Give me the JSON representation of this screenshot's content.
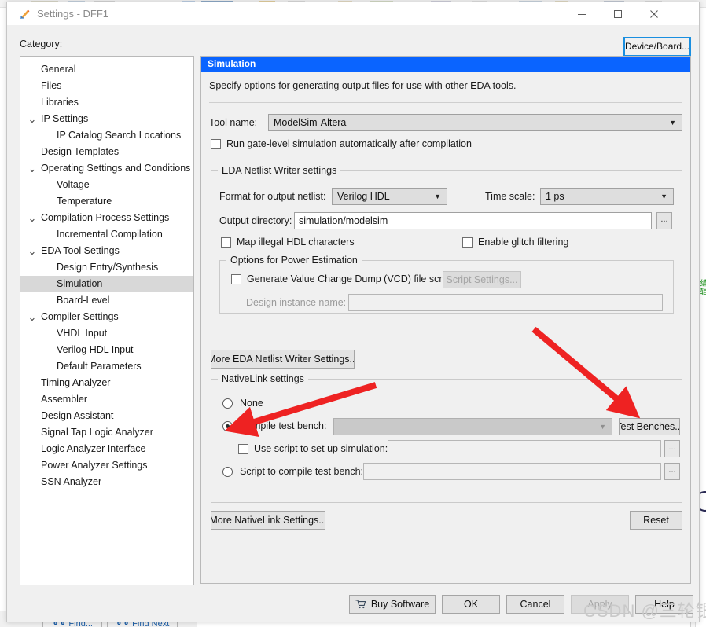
{
  "window": {
    "title": "Settings - DFF1",
    "icon": "pencil-icon",
    "minimize": "—",
    "maximize": "☐",
    "close": "✕"
  },
  "background": {
    "green_text": "编辑",
    "find_button": "Find...",
    "find_next_button": "Find Next"
  },
  "category": {
    "label": "Category:",
    "device_board_button": "Device/Board...",
    "items": [
      {
        "label": "General",
        "depth": 0,
        "expandable": false,
        "selected": false
      },
      {
        "label": "Files",
        "depth": 0,
        "expandable": false,
        "selected": false
      },
      {
        "label": "Libraries",
        "depth": 0,
        "expandable": false,
        "selected": false
      },
      {
        "label": "IP Settings",
        "depth": 0,
        "expandable": true,
        "selected": false
      },
      {
        "label": "IP Catalog Search Locations",
        "depth": 1,
        "expandable": false,
        "selected": false
      },
      {
        "label": "Design Templates",
        "depth": 0,
        "expandable": false,
        "selected": false
      },
      {
        "label": "Operating Settings and Conditions",
        "depth": 0,
        "expandable": true,
        "selected": false
      },
      {
        "label": "Voltage",
        "depth": 1,
        "expandable": false,
        "selected": false
      },
      {
        "label": "Temperature",
        "depth": 1,
        "expandable": false,
        "selected": false
      },
      {
        "label": "Compilation Process Settings",
        "depth": 0,
        "expandable": true,
        "selected": false
      },
      {
        "label": "Incremental Compilation",
        "depth": 1,
        "expandable": false,
        "selected": false
      },
      {
        "label": "EDA Tool Settings",
        "depth": 0,
        "expandable": true,
        "selected": false
      },
      {
        "label": "Design Entry/Synthesis",
        "depth": 1,
        "expandable": false,
        "selected": false
      },
      {
        "label": "Simulation",
        "depth": 1,
        "expandable": false,
        "selected": true
      },
      {
        "label": "Board-Level",
        "depth": 1,
        "expandable": false,
        "selected": false
      },
      {
        "label": "Compiler Settings",
        "depth": 0,
        "expandable": true,
        "selected": false
      },
      {
        "label": "VHDL Input",
        "depth": 1,
        "expandable": false,
        "selected": false
      },
      {
        "label": "Verilog HDL Input",
        "depth": 1,
        "expandable": false,
        "selected": false
      },
      {
        "label": "Default Parameters",
        "depth": 1,
        "expandable": false,
        "selected": false
      },
      {
        "label": "Timing Analyzer",
        "depth": 0,
        "expandable": false,
        "selected": false
      },
      {
        "label": "Assembler",
        "depth": 0,
        "expandable": false,
        "selected": false
      },
      {
        "label": "Design Assistant",
        "depth": 0,
        "expandable": false,
        "selected": false
      },
      {
        "label": "Signal Tap Logic Analyzer",
        "depth": 0,
        "expandable": false,
        "selected": false
      },
      {
        "label": "Logic Analyzer Interface",
        "depth": 0,
        "expandable": false,
        "selected": false
      },
      {
        "label": "Power Analyzer Settings",
        "depth": 0,
        "expandable": false,
        "selected": false
      },
      {
        "label": "SSN Analyzer",
        "depth": 0,
        "expandable": false,
        "selected": false
      }
    ]
  },
  "panel": {
    "header": "Simulation",
    "description": "Specify options for generating output files for use with other EDA tools.",
    "tool_name_label": "Tool name:",
    "tool_name_value": "ModelSim-Altera",
    "run_gate_level_label": "Run gate-level simulation automatically after compilation",
    "run_gate_level_checked": false,
    "netlist_group": {
      "title": "EDA Netlist Writer settings",
      "format_label": "Format for output netlist:",
      "format_value": "Verilog HDL",
      "time_scale_label": "Time scale:",
      "time_scale_value": "1 ps",
      "output_dir_label": "Output directory:",
      "output_dir_value": "simulation/modelsim",
      "browse_label": "...",
      "map_illegal_label": "Map illegal HDL characters",
      "map_illegal_checked": false,
      "glitch_label": "Enable glitch filtering",
      "glitch_checked": false,
      "power_group": {
        "title": "Options for Power Estimation",
        "vcd_label": "Generate Value Change Dump (VCD) file script",
        "vcd_checked": false,
        "script_settings_button": "Script Settings...",
        "script_settings_disabled": true,
        "design_instance_label": "Design instance name:",
        "design_instance_value": "",
        "design_instance_disabled": true
      }
    },
    "more_eda_button": "More EDA Netlist Writer Settings...",
    "nativelink_group": {
      "title": "NativeLink settings",
      "none_label": "None",
      "none_selected": false,
      "compile_tb_label": "Compile test bench:",
      "compile_tb_selected": true,
      "compile_tb_value": "",
      "test_benches_button": "Test Benches...",
      "use_script_label": "Use script to set up simulation:",
      "use_script_checked": false,
      "use_script_value": "",
      "script_compile_label": "Script to compile test bench:",
      "script_compile_selected": false,
      "script_compile_value": "",
      "browse_label": "..."
    },
    "more_nativelink_button": "More NativeLink Settings...",
    "reset_button": "Reset"
  },
  "footer": {
    "buy_software": "Buy Software",
    "ok": "OK",
    "cancel": "Cancel",
    "apply": "Apply",
    "apply_disabled": true,
    "help": "Help"
  },
  "watermark": "CSDN @三轮银",
  "colors": {
    "header_blue": "#0a64ff",
    "focus_blue": "#1a8fe0",
    "arrow_red": "#ee2222",
    "dialog_bg": "#f0f0f0",
    "selected_row": "#d8d8d8"
  }
}
